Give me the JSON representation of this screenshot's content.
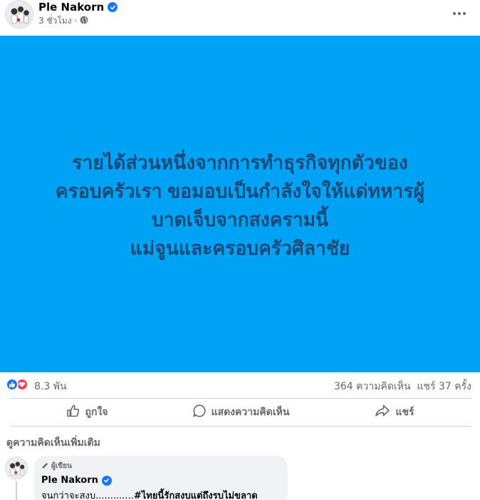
{
  "post": {
    "author": "Ple Nakorn",
    "time": "3 ชั่วโมง ·",
    "text_lines": [
      "รายได้ส่วนหนึ่งจากการทำธุรกิจทุกตัวของ",
      "ครอบครัวเรา ขอมอบเป็นกำลังใจให้แด่ทหารผู้",
      "บาดเจ็บจากสงครามนี้",
      "แม่จูนและครอบครัวศิลาชัย"
    ],
    "bg_color": "#00a2f5",
    "text_color": "#1a4a78"
  },
  "reactions": {
    "count": "8.3 พัน",
    "comments": "364 ความคิดเห็น",
    "shares": "แชร์ 37 ครั้ง"
  },
  "actions": {
    "like": "ถูกใจ",
    "comment": "แสดงความคิดเห็น",
    "share": "แชร์"
  },
  "comments_section": {
    "more_label": "ดูความคิดเห็นเพิ่มเติม",
    "comment": {
      "badge": "ผู้เขียน",
      "author": "Ple Nakorn",
      "text_plain": "จนกว่าจะสงบ.............",
      "text_tag": "#ไทยนี้รักสงบแต่ถึงรบไม่ขลาด"
    }
  },
  "icons": {
    "verified": "verified-badge-icon",
    "globe": "globe-icon",
    "more": "more-options-icon",
    "like": "like-icon",
    "love": "love-icon",
    "comment": "comment-icon",
    "share": "share-icon",
    "author_badge": "author-badge-icon"
  }
}
